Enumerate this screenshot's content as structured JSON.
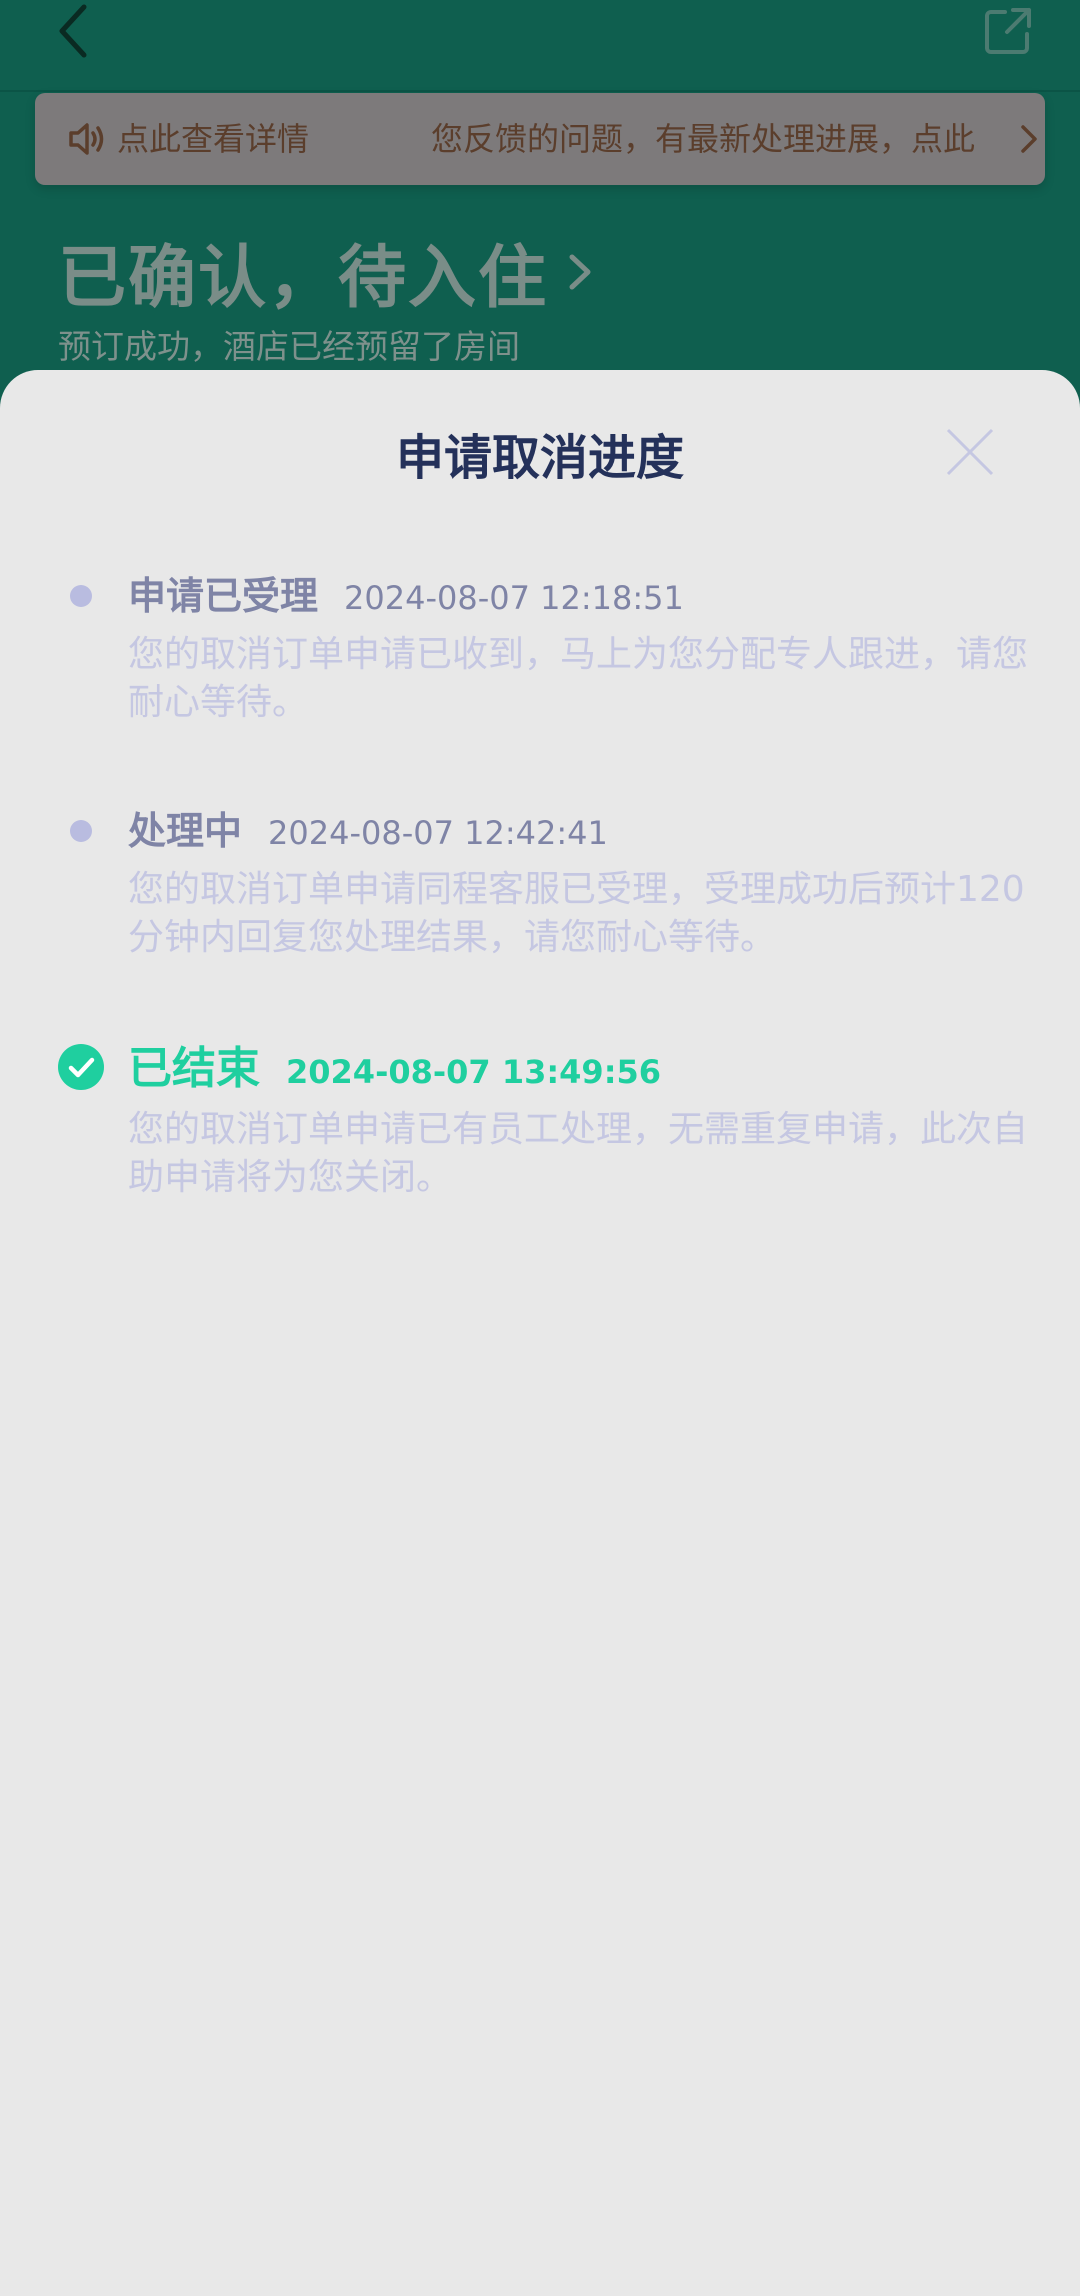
{
  "background": {
    "notice": {
      "text_left": "点此查看详情",
      "text_right": "您反馈的问题，有最新处理进展，点此"
    },
    "order": {
      "status": "已确认，待入住",
      "subtitle": "预订成功，酒店已经预留了房间"
    }
  },
  "sheet": {
    "title": "申请取消进度",
    "steps": [
      {
        "title": "申请已受理",
        "time": "2024-08-07 12:18:51",
        "desc": "您的取消订单申请已收到，马上为您分配专人跟进，请您耐心等待。",
        "state": "past"
      },
      {
        "title": "处理中",
        "time": "2024-08-07 12:42:41",
        "desc": "您的取消订单申请同程客服已受理，受理成功后预计120分钟内回复您处理结果，请您耐心等待。",
        "state": "past"
      },
      {
        "title": "已结束",
        "time": "2024-08-07 13:49:56",
        "desc": "您的取消订单申请已有员工处理，无需重复申请，此次自助申请将为您关闭。",
        "state": "current"
      }
    ]
  },
  "icons": {
    "back": "chevron-left-icon",
    "share": "share-icon",
    "speaker": "speaker-icon",
    "close": "close-icon",
    "check": "check-circle-icon"
  },
  "colors": {
    "header_bg": "#0f5f4f",
    "accent_done": "#1fcf9f",
    "title": "#24315a",
    "step_past": "#7f84a6",
    "desc": "#c5c7e2"
  }
}
